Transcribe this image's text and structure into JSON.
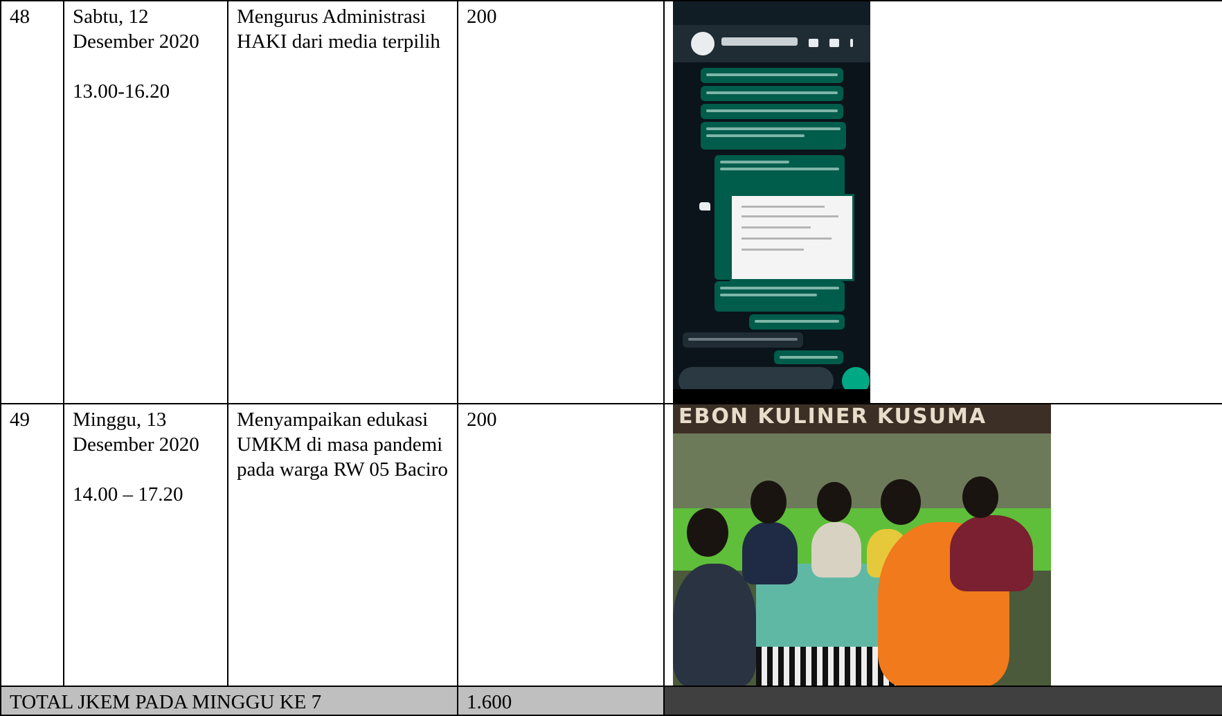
{
  "rows": [
    {
      "no": "48",
      "date": "Sabtu, 12 Desember 2020",
      "time": "13.00-16.20",
      "activity": "Mengurus Administrasi HAKI dari media terpilih",
      "jkem": "200"
    },
    {
      "no": "49",
      "date": "Minggu, 13 Desember 2020",
      "time": "14.00 – 17.20",
      "activity": "Menyampaikan edukasi UMKM di masa pandemi pada  warga RW 05 Baciro",
      "jkem": "200"
    }
  ],
  "total": {
    "label": "TOTAL JKEM PADA MINGGU KE 7",
    "value": "1.600"
  },
  "photo": {
    "sign_text": "EBON   KULINER KUSUMA"
  },
  "colors": {
    "total_row_bg": "#bfbfbf",
    "total_dark_bg": "#404040",
    "whatsapp_dark": "#0b141a",
    "whatsapp_bubble": "#005c4b"
  }
}
